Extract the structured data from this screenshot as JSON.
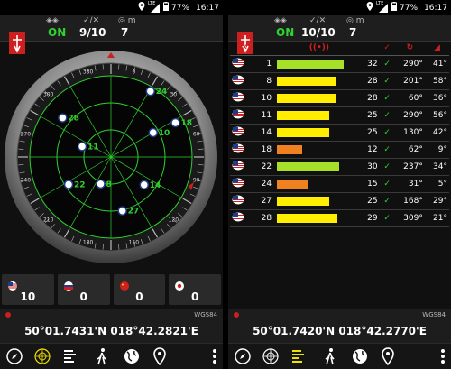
{
  "status_bar": {
    "lte_label": "LTE",
    "battery": "77%",
    "time": "16:17"
  },
  "left": {
    "header": {
      "fix_label": "ON",
      "sats_used": "9/10",
      "sats_in_view": "7"
    },
    "compass": {
      "heading_labels": [
        "0",
        "30",
        "60",
        "90",
        "120",
        "150",
        "180",
        "210",
        "240",
        "270",
        "300",
        "330"
      ],
      "satellites": [
        {
          "id": "22"
        },
        {
          "id": "28"
        },
        {
          "id": "8"
        },
        {
          "id": "11"
        },
        {
          "id": "27"
        },
        {
          "id": "14"
        },
        {
          "id": "10"
        },
        {
          "id": "24"
        },
        {
          "id": "18"
        }
      ]
    },
    "constellation_counts": [
      {
        "flag": "us-flag-icon",
        "value": "10"
      },
      {
        "flag": "russia-flag-icon",
        "value": "0"
      },
      {
        "flag": "china-flag-icon",
        "value": "0"
      },
      {
        "flag": "japan-flag-icon",
        "value": "0"
      }
    ],
    "location": {
      "datum": "WGS84",
      "coords": "50°01.7431'N  018°42.2821'E"
    }
  },
  "right": {
    "header": {
      "fix_label": "ON",
      "sats_used": "10/10",
      "sats_in_view": "7"
    },
    "table": {
      "rows": [
        {
          "prn": "1",
          "snr": "32",
          "snr_value": 32,
          "bar_color": "#a6e028",
          "azimuth": "290°",
          "elevation": "41°"
        },
        {
          "prn": "8",
          "snr": "28",
          "snr_value": 28,
          "bar_color": "#ffee00",
          "azimuth": "201°",
          "elevation": "58°"
        },
        {
          "prn": "10",
          "snr": "28",
          "snr_value": 28,
          "bar_color": "#ffee00",
          "azimuth": "60°",
          "elevation": "36°"
        },
        {
          "prn": "11",
          "snr": "25",
          "snr_value": 25,
          "bar_color": "#ffee00",
          "azimuth": "290°",
          "elevation": "56°"
        },
        {
          "prn": "14",
          "snr": "25",
          "snr_value": 25,
          "bar_color": "#ffee00",
          "azimuth": "130°",
          "elevation": "42°"
        },
        {
          "prn": "18",
          "snr": "12",
          "snr_value": 12,
          "bar_color": "#f08020",
          "azimuth": "62°",
          "elevation": "9°"
        },
        {
          "prn": "22",
          "snr": "30",
          "snr_value": 30,
          "bar_color": "#a6e028",
          "azimuth": "237°",
          "elevation": "34°"
        },
        {
          "prn": "24",
          "snr": "15",
          "snr_value": 15,
          "bar_color": "#f08020",
          "azimuth": "31°",
          "elevation": "5°"
        },
        {
          "prn": "27",
          "snr": "25",
          "snr_value": 25,
          "bar_color": "#ffee00",
          "azimuth": "168°",
          "elevation": "29°"
        },
        {
          "prn": "28",
          "snr": "29",
          "snr_value": 29,
          "bar_color": "#ffee00",
          "azimuth": "309°",
          "elevation": "21°"
        }
      ]
    },
    "location": {
      "datum": "WGS84",
      "coords": "50°01.7420'N  018°42.2770'E"
    }
  },
  "colors": {
    "accent_green": "#2fd12f",
    "accent_red": "#cc1f1f"
  }
}
